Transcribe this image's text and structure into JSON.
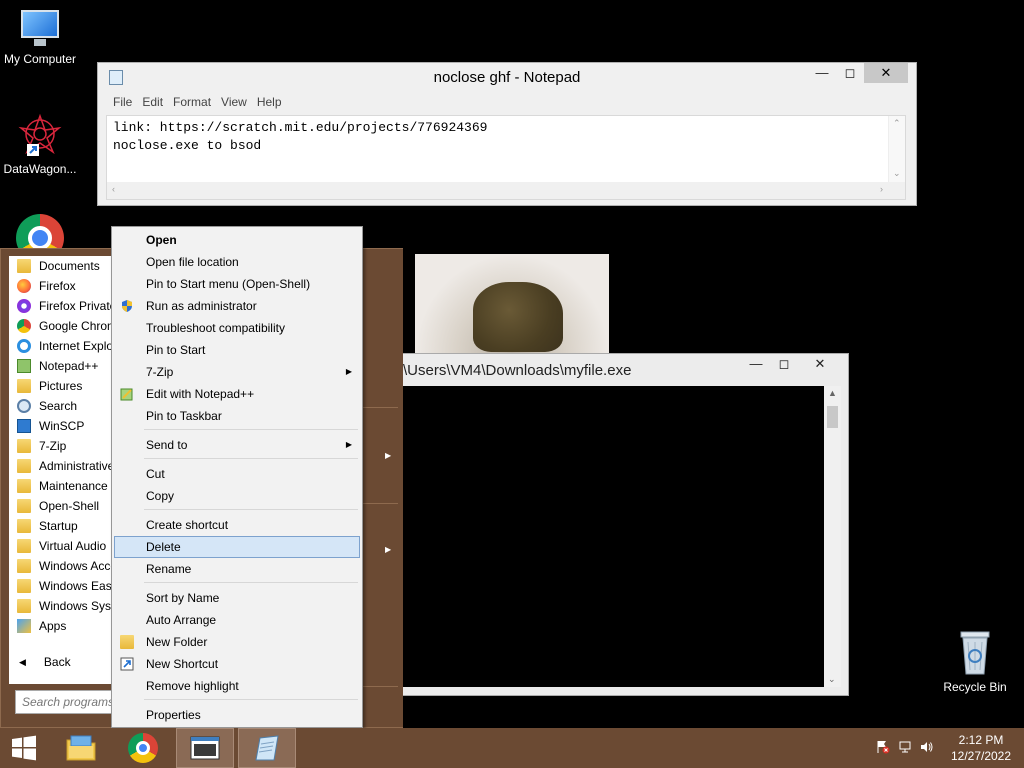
{
  "desktop": {
    "icons": [
      {
        "label": "My Computer"
      },
      {
        "label": "DataWagon..."
      },
      {
        "label": "Recycle Bin"
      }
    ]
  },
  "notepad": {
    "title": "noclose ghf - Notepad",
    "menu": [
      "File",
      "Edit",
      "Format",
      "View",
      "Help"
    ],
    "content": "link: https://scratch.mit.edu/projects/776924369\nnoclose.exe to bsod"
  },
  "console": {
    "title": "\\Users\\VM4\\Downloads\\myfile.exe"
  },
  "start_menu": {
    "items": [
      {
        "label": "Documents",
        "icon": "folder-icon"
      },
      {
        "label": "Firefox",
        "icon": "firefox-icon"
      },
      {
        "label": "Firefox Private",
        "icon": "firefox-private-icon"
      },
      {
        "label": "Google Chrome",
        "icon": "chrome-icon"
      },
      {
        "label": "Internet Explorer",
        "icon": "ie-icon"
      },
      {
        "label": "Notepad++",
        "icon": "notepadpp-icon"
      },
      {
        "label": "Pictures",
        "icon": "folder-icon"
      },
      {
        "label": "Search",
        "icon": "search-icon"
      },
      {
        "label": "WinSCP",
        "icon": "winscp-icon"
      },
      {
        "label": "7-Zip",
        "icon": "folder-icon"
      },
      {
        "label": "Administrative Tools",
        "icon": "folder-icon"
      },
      {
        "label": "Maintenance",
        "icon": "folder-icon"
      },
      {
        "label": "Open-Shell",
        "icon": "folder-icon"
      },
      {
        "label": "Startup",
        "icon": "folder-icon"
      },
      {
        "label": "Virtual Audio",
        "icon": "folder-icon"
      },
      {
        "label": "Windows Accessories",
        "icon": "folder-icon"
      },
      {
        "label": "Windows Ease of Access",
        "icon": "folder-icon"
      },
      {
        "label": "Windows System",
        "icon": "folder-icon"
      },
      {
        "label": "Apps",
        "icon": "apps-icon"
      }
    ],
    "back_label": "Back",
    "search_placeholder": "Search programs and files"
  },
  "context_menu": {
    "items": [
      {
        "label": "Open"
      },
      {
        "label": "Open file location"
      },
      {
        "label": "Pin to Start menu (Open-Shell)"
      },
      {
        "label": "Run as administrator",
        "icon": "shield-icon"
      },
      {
        "label": "Troubleshoot compatibility"
      },
      {
        "label": "Pin to Start"
      },
      {
        "label": "7-Zip"
      },
      {
        "label": "Edit with Notepad++",
        "icon": "notepadpp-icon"
      },
      {
        "label": "Pin to Taskbar"
      },
      {
        "label": "Send to"
      },
      {
        "label": "Cut"
      },
      {
        "label": "Copy"
      },
      {
        "label": "Create shortcut"
      },
      {
        "label": "Delete"
      },
      {
        "label": "Rename"
      },
      {
        "label": "Sort by Name"
      },
      {
        "label": "Auto Arrange"
      },
      {
        "label": "New Folder",
        "icon": "folder-icon"
      },
      {
        "label": "New Shortcut",
        "icon": "shortcut-icon"
      },
      {
        "label": "Remove highlight"
      },
      {
        "label": "Properties"
      }
    ],
    "highlighted": "Delete"
  },
  "taskbar": {
    "clock_time": "2:12 PM",
    "clock_date": "12/27/2022",
    "pinned": [
      "windows-start-icon",
      "file-explorer-icon",
      "chrome-icon",
      "console-icon",
      "notepad-icon"
    ]
  },
  "colors": {
    "taskbar": "#6b4a33",
    "highlight": "#d5e6f7"
  }
}
